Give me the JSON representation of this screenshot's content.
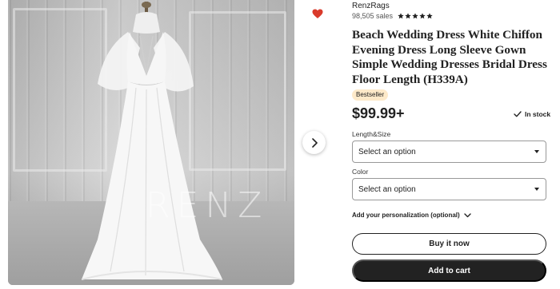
{
  "shop": {
    "name": "RenzRags",
    "sales": "98,505 sales",
    "rating_stars": 5
  },
  "product": {
    "title": "Beach Wedding Dress White Chiffon Evening Dress Long Sleeve Gown Simple Wedding Dresses Bridal Dress Floor Length (H339A)",
    "badge": "Bestseller",
    "price": "$99.99+",
    "stock": "In stock",
    "image_watermark": "RENZ"
  },
  "options": {
    "size_label": "Length&Size",
    "size_value": "Select an option",
    "color_label": "Color",
    "color_value": "Select an option",
    "personalization": "Add your personalization (optional)"
  },
  "actions": {
    "buy_now": "Buy it now",
    "add_to_cart": "Add to cart"
  },
  "icons": {
    "favorite": "heart-icon",
    "next": "chevron-right-icon",
    "stock": "check-icon",
    "expand": "chevron-down-icon",
    "rating": "star-icon"
  },
  "colors": {
    "favorite": "#d93a2b",
    "badge_bg": "#fde9c9",
    "button_dark": "#222222"
  }
}
